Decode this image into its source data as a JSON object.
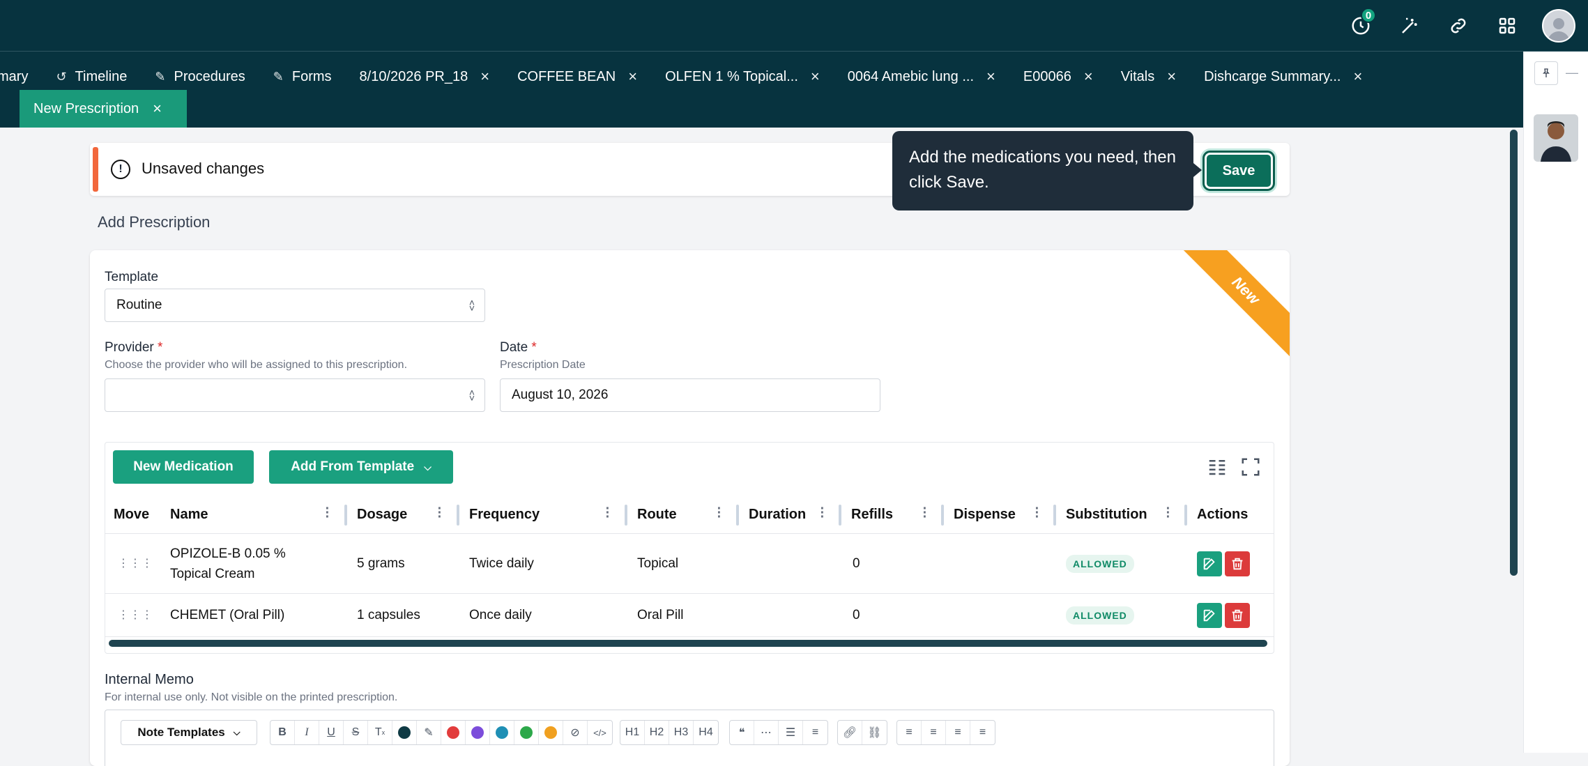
{
  "topbar": {
    "notification_count": "0",
    "icons": [
      "clock-icon",
      "magic-wand-icon",
      "link-icon",
      "grid-icon",
      "user-avatar"
    ]
  },
  "tabs": [
    {
      "label": "mary",
      "icon": "",
      "closable": false
    },
    {
      "label": "Timeline",
      "icon": "history-icon",
      "closable": false
    },
    {
      "label": "Procedures",
      "icon": "pen-icon",
      "closable": false
    },
    {
      "label": "Forms",
      "icon": "pen-icon",
      "closable": false
    },
    {
      "label": "8/10/2026 PR_18",
      "icon": "",
      "closable": true
    },
    {
      "label": "COFFEE BEAN",
      "icon": "",
      "closable": true
    },
    {
      "label": "OLFEN 1 % Topical...",
      "icon": "",
      "closable": true
    },
    {
      "label": "0064 Amebic lung ...",
      "icon": "",
      "closable": true
    },
    {
      "label": "E00066",
      "icon": "",
      "closable": true
    },
    {
      "label": "Vitals",
      "icon": "",
      "closable": true
    },
    {
      "label": "Dishcarge Summary...",
      "icon": "",
      "closable": true
    }
  ],
  "active_tab": {
    "label": "New Prescription"
  },
  "close_glyph": "×",
  "banner": {
    "icon": "!",
    "text": "Unsaved changes",
    "save_label": "Save"
  },
  "tooltip": {
    "text": "Add the medications you need, then click Save."
  },
  "page": {
    "section_title": "Add Prescription",
    "ribbon": "New"
  },
  "form": {
    "template": {
      "label": "Template",
      "value": "Routine"
    },
    "provider": {
      "label": "Provider",
      "required": "*",
      "help": "Choose the provider who will be assigned to this prescription.",
      "value": ""
    },
    "date": {
      "label": "Date",
      "required": "*",
      "help": "Prescription Date",
      "value": "August 10, 2026"
    }
  },
  "grid": {
    "new_med_label": "New Medication",
    "add_template_label": "Add From Template",
    "columns": [
      "Move",
      "Name",
      "Dosage",
      "Frequency",
      "Route",
      "Duration",
      "Refills",
      "Dispense",
      "Substitution",
      "Actions"
    ],
    "rows": [
      {
        "name_line1": "OPIZOLE-B 0.05 %",
        "name_line2": "Topical Cream",
        "dosage": "5 grams",
        "frequency": "Twice daily",
        "route": "Topical",
        "duration": "",
        "refills": "0",
        "dispense": "",
        "substitution": "ALLOWED"
      },
      {
        "name_line1": "CHEMET (Oral Pill)",
        "name_line2": "",
        "dosage": "1 capsules",
        "frequency": "Once daily",
        "route": "Oral Pill",
        "duration": "",
        "refills": "0",
        "dispense": "",
        "substitution": "ALLOWED"
      }
    ]
  },
  "memo": {
    "title": "Internal Memo",
    "help": "For internal use only. Not visible on the printed prescription.",
    "note_templates_label": "Note Templates",
    "headings": [
      "H1",
      "H2",
      "H3",
      "H4"
    ],
    "colors": [
      "#0f3a44",
      "#e23c3c",
      "#7c4ddb",
      "#1f8fb5",
      "#2da84a",
      "#f0a020"
    ]
  },
  "colors": {
    "primary": "#1aa07f",
    "header": "#07333f",
    "danger": "#dc3b3b",
    "warning": "#f2673c",
    "ribbon": "#f7a020"
  }
}
